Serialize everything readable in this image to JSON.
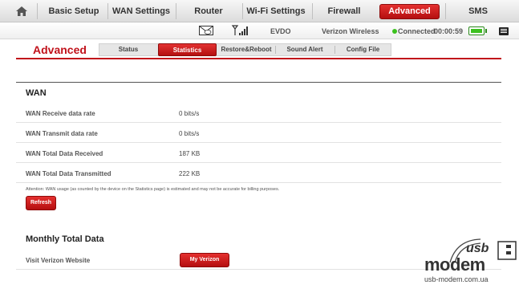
{
  "nav": {
    "items": [
      "Basic Setup",
      "WAN Settings",
      "Router",
      "Wi-Fi Settings",
      "Firewall",
      "Advanced",
      "SMS"
    ],
    "active": "Advanced"
  },
  "status": {
    "network": "EVDO",
    "carrier": "Verizon Wireless",
    "connection": "Connected",
    "timer": "00:00:59",
    "accent": "#3cc11f"
  },
  "page": {
    "title": "Advanced",
    "tabs": [
      "Status",
      "Statistics",
      "Restore&Reboot",
      "Sound Alert",
      "Config File"
    ],
    "active_tab": "Statistics"
  },
  "wan": {
    "title": "WAN",
    "rows": [
      {
        "label": "WAN Receive data rate",
        "value": "0 bits/s"
      },
      {
        "label": "WAN Transmit data rate",
        "value": "0 bits/s"
      },
      {
        "label": "WAN Total Data Received",
        "value": "187 KB"
      },
      {
        "label": "WAN Total Data Transmitted",
        "value": "222 KB"
      }
    ],
    "note": "Attention: WAN usage (as counted by the device on the Statistics page) is estimated and may not be accurate for billing purposes.",
    "refresh_label": "Refresh"
  },
  "monthly": {
    "title": "Monthly Total Data",
    "link_label": "Visit Verizon Website",
    "button_label": "My Verizon"
  },
  "watermark": {
    "brand": "modem",
    "brand_usb": "usb",
    "url": "usb-modem.com.ua"
  },
  "colors": {
    "brand_red": "#c1121b",
    "button_red": "#d41f1f"
  }
}
